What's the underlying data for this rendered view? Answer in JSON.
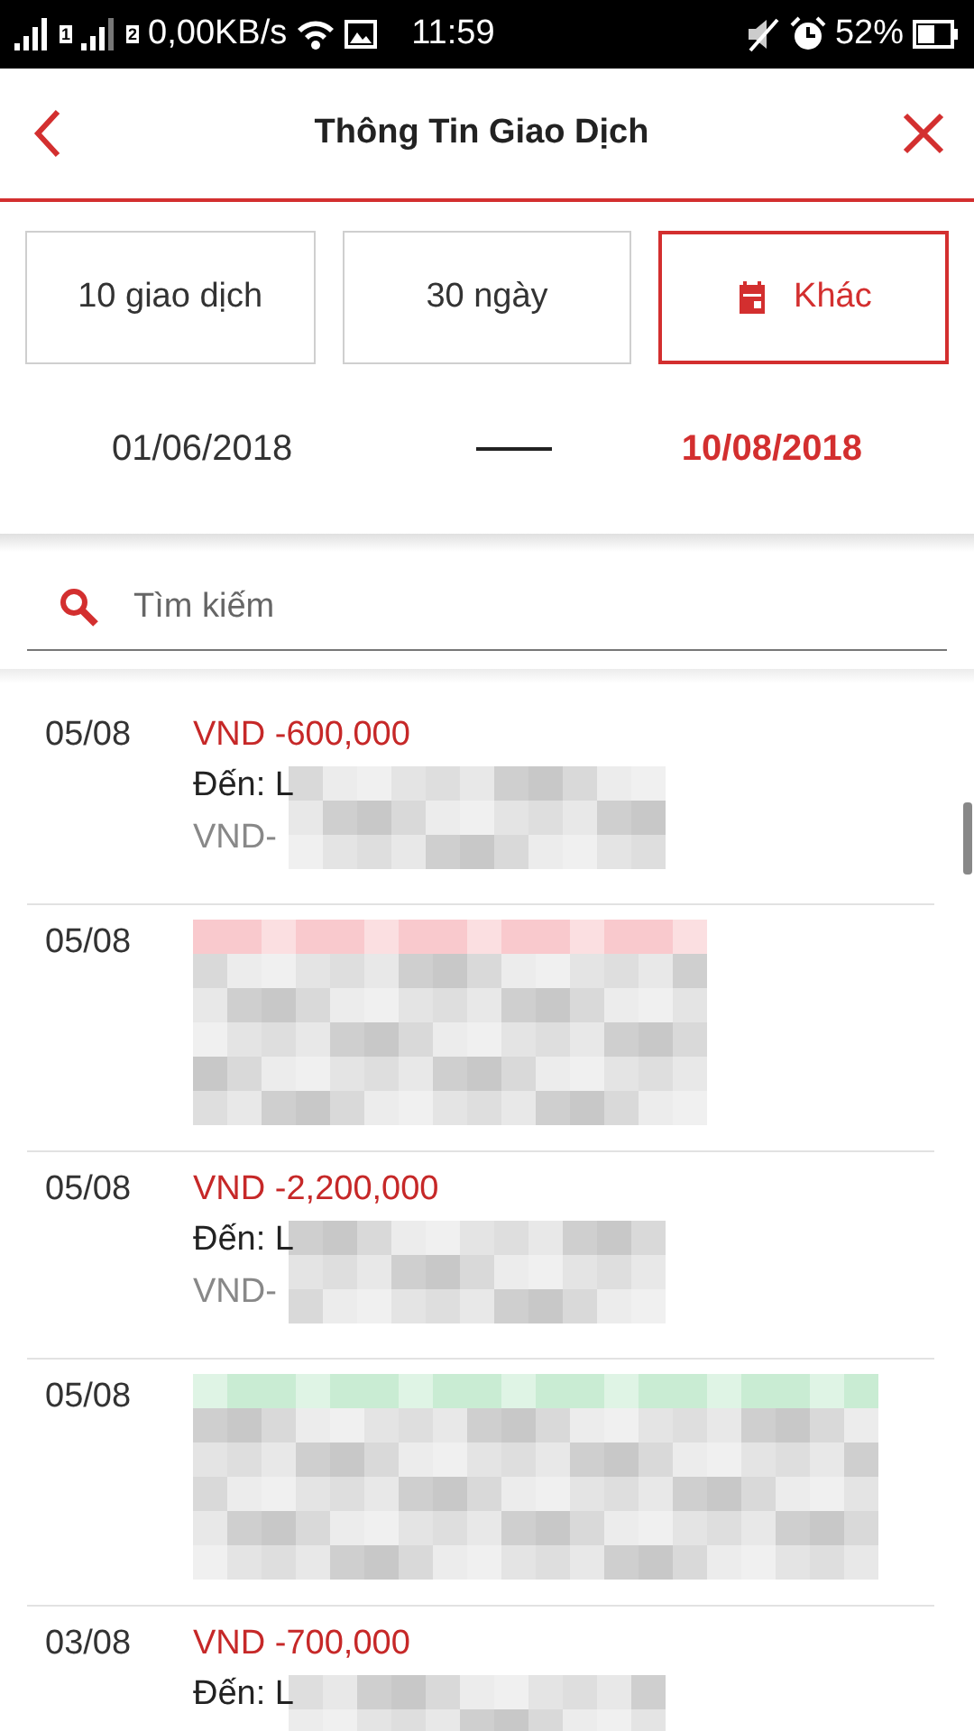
{
  "status_bar": {
    "sim_1": "1",
    "sim_2": "2",
    "speed": "0,00KB/s",
    "time": "11:59",
    "battery": "52%"
  },
  "header": {
    "title": "Thông Tin Giao Dịch"
  },
  "filters": [
    {
      "label": "10 giao dịch",
      "selected": false,
      "kind": "text"
    },
    {
      "label": "30 ngày",
      "selected": false,
      "kind": "text"
    },
    {
      "label": "Khác",
      "selected": true,
      "kind": "calendar"
    }
  ],
  "date_range": {
    "from": "01/06/2018",
    "to": "10/08/2018"
  },
  "search": {
    "placeholder": "Tìm kiếm"
  },
  "transactions": [
    {
      "kind": "transfer",
      "date": "05/08",
      "amount": "VND -600,000",
      "recipient": "Đến: L",
      "reference": "VND-"
    },
    {
      "kind": "masked",
      "date": "05/08",
      "color": "#f9c9cd"
    },
    {
      "kind": "transfer",
      "date": "05/08",
      "amount": "VND -2,200,000",
      "recipient": "Đến: L",
      "reference": "VND-"
    },
    {
      "kind": "masked",
      "date": "05/08",
      "color": "#c9ecd3"
    },
    {
      "kind": "transfer",
      "date": "03/08",
      "amount": "VND -700,000",
      "recipient": "Đến: L"
    }
  ]
}
